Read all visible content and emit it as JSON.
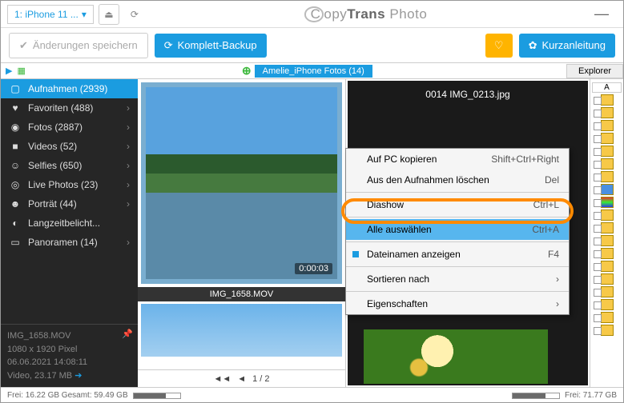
{
  "titlebar": {
    "device": "1: iPhone 11 ...",
    "app_pre": "opy",
    "app_mid": "Trans",
    "app_post": " Photo"
  },
  "toolbar": {
    "save": "Änderungen speichern",
    "backup": "Komplett-Backup",
    "guide": "Kurzanleitung"
  },
  "row1": {
    "explorer": "Explorer"
  },
  "sidebar": {
    "items": [
      {
        "icon": "camera",
        "label": "Aufnahmen (2939)"
      },
      {
        "icon": "heart",
        "label": "Favoriten (488)"
      },
      {
        "icon": "photo",
        "label": "Fotos (2887)"
      },
      {
        "icon": "video",
        "label": "Videos (52)"
      },
      {
        "icon": "selfie",
        "label": "Selfies (650)"
      },
      {
        "icon": "live",
        "label": "Live Photos (23)"
      },
      {
        "icon": "portrait",
        "label": "Porträt (44)"
      },
      {
        "icon": "long",
        "label": "Langzeitbelicht..."
      },
      {
        "icon": "pano",
        "label": "Panoramen (14)"
      }
    ],
    "meta": {
      "l1": "IMG_1658.MOV",
      "l2": "1080 x 1920 Pixel",
      "l3": "06.06.2021 14:08:11",
      "l4": "Video, 23.17 MB"
    }
  },
  "thumb": {
    "duration": "0:00:03",
    "label": "IMG_1658.MOV",
    "page": "1 / 2"
  },
  "album": {
    "name": "Amelie_iPhone Fotos (14)",
    "image": "0014 IMG_0213.jpg",
    "thumbhead": "A"
  },
  "ctx": {
    "copy": {
      "t": "Auf PC kopieren",
      "s": "Shift+Ctrl+Right"
    },
    "del": {
      "t": "Aus den Aufnahmen löschen",
      "s": "Del"
    },
    "dia": {
      "t": "Diashow",
      "s": "Ctrl+L"
    },
    "all": {
      "t": "Alle auswählen",
      "s": "Ctrl+A"
    },
    "names": {
      "t": "Dateinamen anzeigen",
      "s": "F4"
    },
    "sort": {
      "t": "Sortieren nach"
    },
    "props": {
      "t": "Eigenschaften"
    }
  },
  "status": {
    "left": "Frei: 16.22 GB Gesamt: 59.49 GB",
    "right": "Frei: 71.77 GB"
  }
}
